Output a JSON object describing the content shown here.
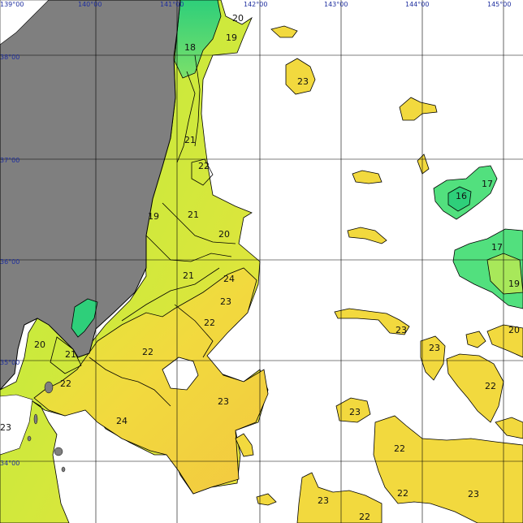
{
  "map": {
    "longitude_labels": [
      "139°00",
      "140°00",
      "141°00",
      "142°00",
      "143°00",
      "144°00",
      "145°00"
    ],
    "latitude_labels": [
      "38°00",
      "37°00",
      "36°00",
      "35°00",
      "34°00"
    ],
    "isotherm_labels": [
      "20",
      "19",
      "18",
      "23",
      "21",
      "22",
      "19",
      "21",
      "20",
      "17",
      "16",
      "21",
      "24",
      "23",
      "22",
      "17",
      "19",
      "20",
      "21",
      "22",
      "23",
      "22",
      "23",
      "24",
      "23",
      "23",
      "22",
      "22",
      "23",
      "22",
      "23",
      "22",
      "20"
    ],
    "colors": {
      "land": "#7f7f7f",
      "grid": "#000000",
      "sst_16": "#2ecf7a",
      "sst_17": "#52e07e",
      "sst_18": "#7be06a",
      "sst_19": "#a8e85a",
      "sst_20": "#c9ea3c",
      "sst_21": "#dde93a",
      "sst_22": "#ece23c",
      "sst_23": "#f2d93e",
      "sst_24": "#f3c840",
      "label": "#1f2f9f"
    }
  }
}
